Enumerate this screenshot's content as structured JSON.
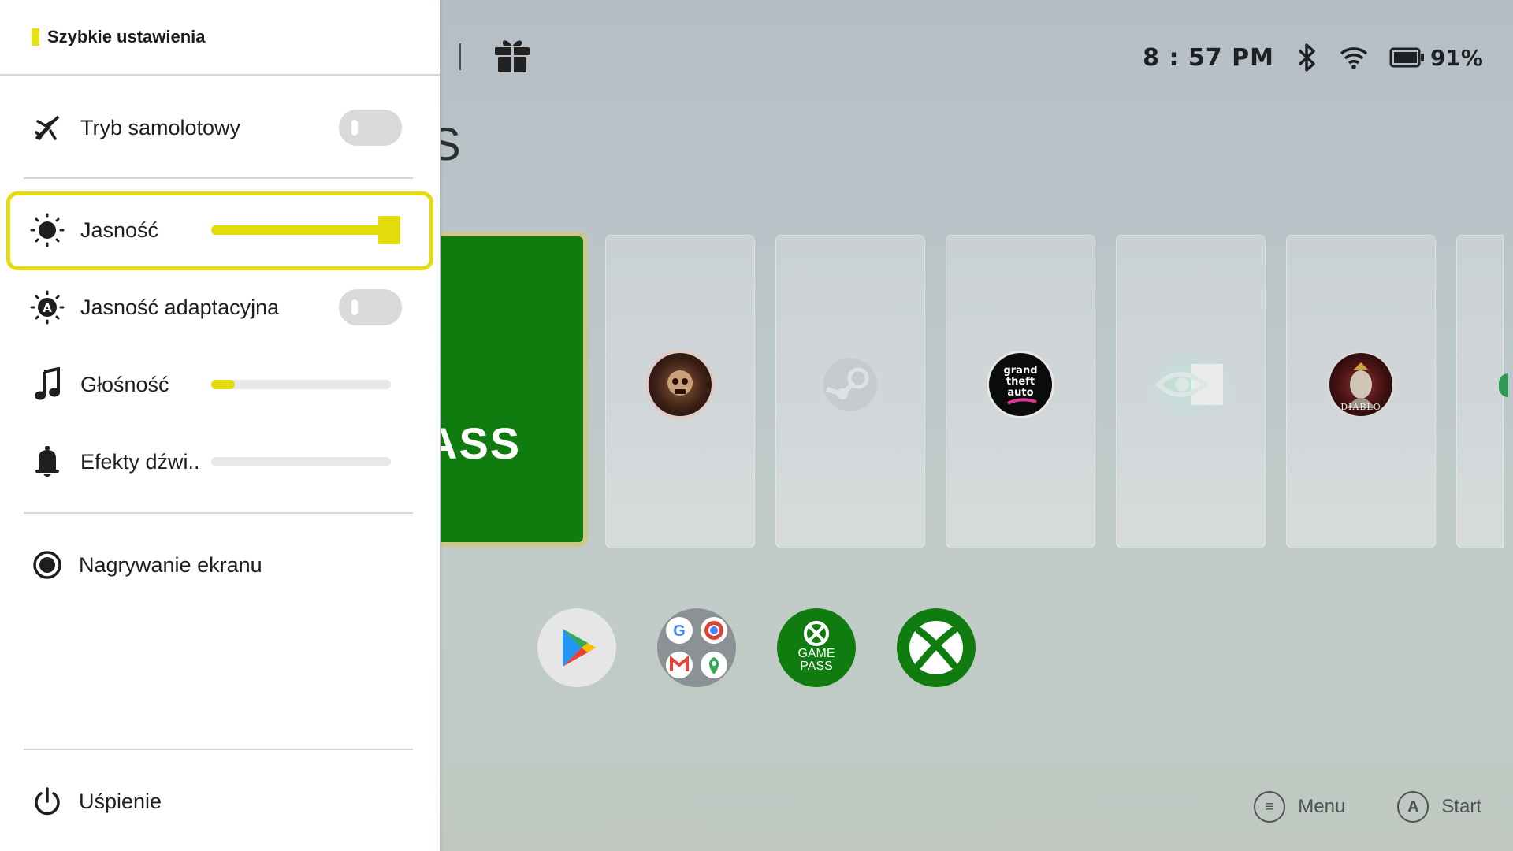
{
  "quick_settings": {
    "title": "Szybkie ustawienia",
    "accent_color": "#e3db0c",
    "airplane": {
      "label": "Tryb samolotowy",
      "icon": "airplane-off-icon",
      "enabled": false
    },
    "brightness": {
      "label": "Jasność",
      "icon": "brightness-icon",
      "level": 1.0
    },
    "adaptive_brightness": {
      "label": "Jasność adaptacyjna",
      "icon": "adaptive-brightness-icon",
      "enabled": false
    },
    "volume": {
      "label": "Głośność",
      "icon": "music-note-icon",
      "level": 0.13
    },
    "sound_effects": {
      "label": "Efekty dźwi..",
      "icon": "bell-icon",
      "level": 0.0
    },
    "screen_recording": {
      "label": "Nagrywanie ekranu",
      "icon": "record-icon"
    },
    "sleep": {
      "label": "Uśpienie",
      "icon": "power-icon"
    }
  },
  "status_bar": {
    "time": "8 : 57 PM",
    "battery_percent": "91%",
    "icons": [
      "bluetooth-icon",
      "wifi-icon",
      "battery-icon"
    ]
  },
  "launcher": {
    "heading_partial": "S",
    "featured_tile_text": "ASS",
    "featured_color": "#107c10",
    "tiles": [
      "baldurs-gate-logo",
      "steam-logo",
      "gta-vice-city-logo",
      "nvidia-logo",
      "diablo-logo",
      "partial-tile"
    ],
    "gta_logo_text": [
      "grand",
      "theft",
      "auto"
    ],
    "diablo_logo_text": "DIABLO",
    "apps": [
      "google-play-icon",
      "google-apps-folder-icon",
      "game-pass-icon",
      "xbox-icon"
    ],
    "gamepass_text": [
      "GAME",
      "PASS"
    ]
  },
  "hints": {
    "menu": {
      "button": "≡",
      "label": "Menu"
    },
    "start": {
      "button": "A",
      "label": "Start"
    }
  }
}
